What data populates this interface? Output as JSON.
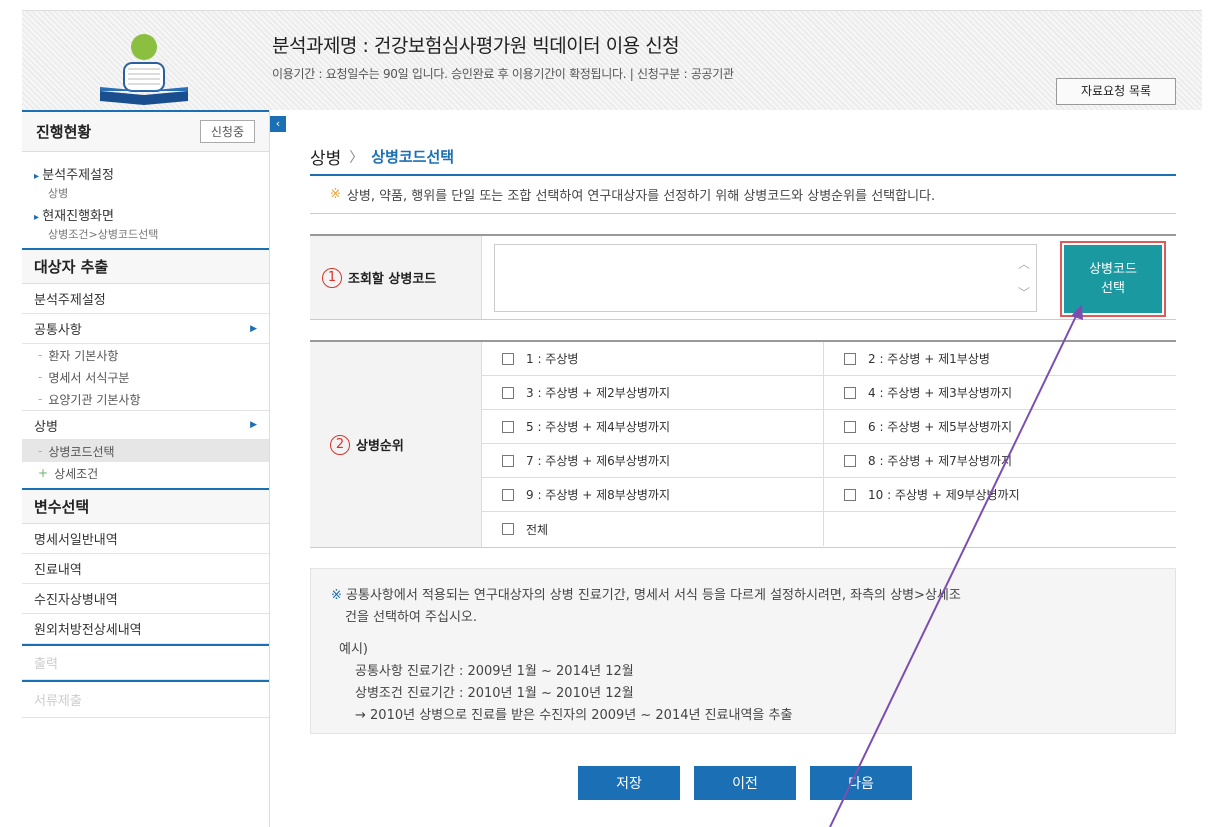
{
  "header": {
    "title": "분석과제명 : 건강보험심사평가원 빅데이터 이용 신청",
    "subtitle": "이용기간 : 요청일수는 90일 입니다. 승인완료 후 이용기간이 확정됩니다.  |  신청구분 : 공공기관",
    "request_list_button": "자료요청 목록"
  },
  "sidebar": {
    "progress_title": "진행현황",
    "progress_badge": "신청중",
    "status": [
      {
        "label": "분석주제설정",
        "sub": "상병"
      },
      {
        "label": "현재진행화면",
        "sub": "상병조건>상병코드선택"
      }
    ],
    "extract_title": "대상자 추출",
    "items": [
      {
        "label": "분석주제설정"
      },
      {
        "label": "공통사항"
      },
      {
        "label": "환자 기본사항"
      },
      {
        "label": "명세서 서식구분"
      },
      {
        "label": "요양기관 기본사항"
      },
      {
        "label": "상병"
      },
      {
        "label": "상병코드선택"
      },
      {
        "label": "상세조건"
      }
    ],
    "variable_title": "변수선택",
    "variable_items": [
      "명세서일반내역",
      "진료내역",
      "수진자상병내역",
      "원외처방전상세내역"
    ],
    "output_label": "출력",
    "submit_label": "서류제출",
    "collapse_icon": "‹"
  },
  "main": {
    "crumb_parent": "상병",
    "crumb_sep": "〉",
    "crumb_current": "상병코드선택",
    "notice": "상병, 약품, 행위를 단일 또는 조합 선택하여 연구대상자를 선정하기 위해 상병코드와 상병순위를 선택합니다.",
    "notice_mark": "※",
    "row1_num": "1",
    "row1_label": "조회할 상병코드",
    "code_button_line1": "상병코드",
    "code_button_line2": "선택",
    "row2_num": "2",
    "row2_label": "상병순위",
    "ranks": [
      "1 : 주상병",
      "2 : 주상병 + 제1부상병",
      "3 : 주상병 + 제2부상병까지",
      "4 : 주상병 + 제3부상병까지",
      "5 : 주상병 + 제4부상병까지",
      "6 : 주상병 + 제5부상병까지",
      "7 : 주상병 + 제6부상병까지",
      "8 : 주상병 + 제7부상병까지",
      "9 : 주상병 + 제8부상병까지",
      "10 : 주상병 + 제9부상병까지",
      "전체"
    ],
    "info_mark": "※",
    "info_line1": "공통사항에서 적용되는 연구대상자의 상병 진료기간, 명세서 서식 등을 다르게 설정하시려면, 좌측의 상병>상세조",
    "info_line2": "건을 선택하여 주십시오.",
    "example_title": "예시)",
    "example_lines": [
      "공통사항 진료기간 : 2009년 1월 ~ 2014년 12월",
      "상병조건 진료기간 : 2010년 1월 ~ 2010년 12월",
      "→ 2010년 상병으로 진료를 받은 수진자의 2009년 ~ 2014년 진료내역을 추출"
    ],
    "buttons": {
      "save": "저장",
      "prev": "이전",
      "next": "다음"
    }
  },
  "colors": {
    "accent": "#1a6fb5",
    "teal": "#1a9aa0",
    "annotation_line": "#7b4fb0",
    "highlight_border": "#e05a5a"
  }
}
